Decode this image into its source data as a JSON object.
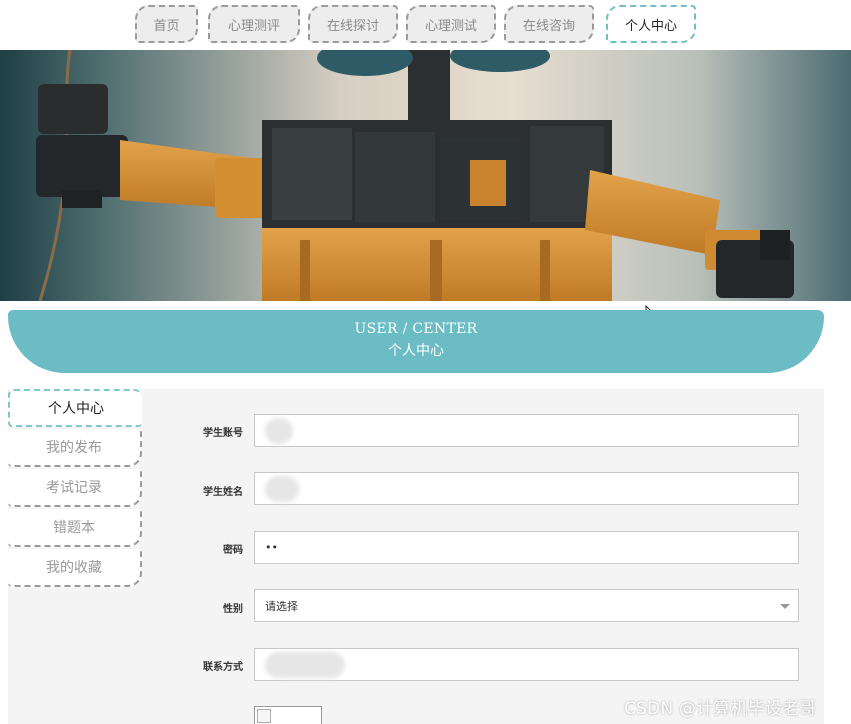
{
  "nav": {
    "items": [
      {
        "label": "首页"
      },
      {
        "label": "心理测评"
      },
      {
        "label": "在线探讨"
      },
      {
        "label": "心理测试"
      },
      {
        "label": "在线咨询"
      },
      {
        "label": "个人中心",
        "active": true
      }
    ]
  },
  "banner": {
    "alt_icon": "robot-banner-image"
  },
  "header": {
    "title_en": "USER / CENTER",
    "title_cn": "个人中心"
  },
  "sidebar": {
    "items": [
      {
        "label": "个人中心",
        "active": true
      },
      {
        "label": "我的发布"
      },
      {
        "label": "考试记录"
      },
      {
        "label": "错题本"
      },
      {
        "label": "我的收藏"
      }
    ]
  },
  "form": {
    "student_account_label": "学生账号",
    "student_name_label": "学生姓名",
    "password_label": "密码",
    "password_value": "••",
    "gender_label": "性别",
    "gender_value": "请选择",
    "contact_label": "联系方式"
  },
  "watermark": "CSDN @计算机毕设老哥",
  "colors": {
    "accent": "#6cbcc5",
    "content_bg": "#f4f4f4",
    "nav_bg": "#ededed"
  }
}
